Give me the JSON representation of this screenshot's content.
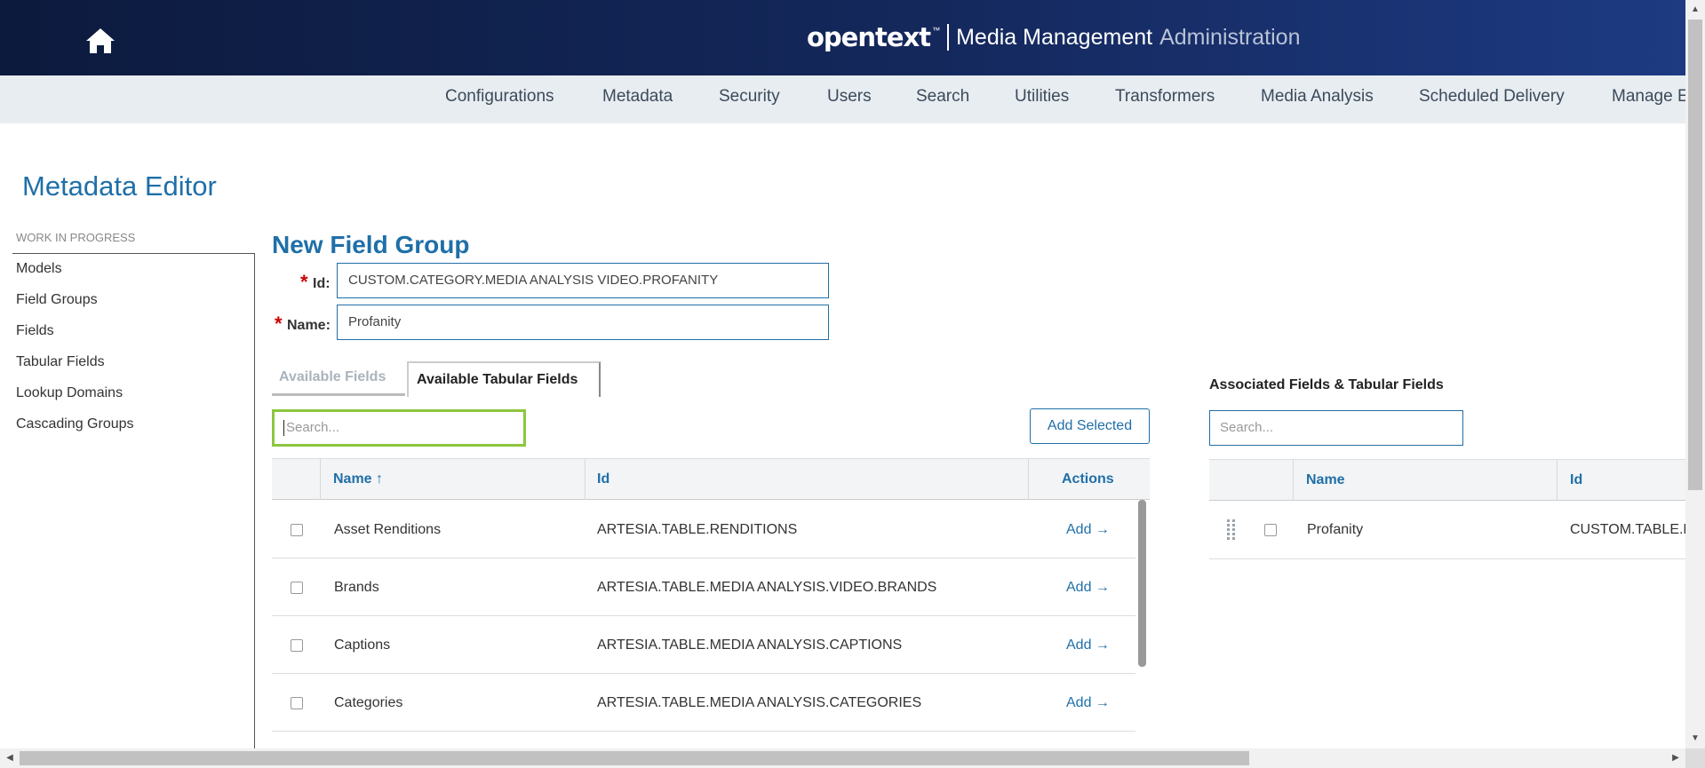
{
  "header": {
    "brand_logo": "opentext",
    "brand_tm": "™",
    "app_name": "Media Management",
    "app_name_suffix": "Administration"
  },
  "nav": {
    "items": [
      "Configurations",
      "Metadata",
      "Security",
      "Users",
      "Search",
      "Utilities",
      "Transformers",
      "Media Analysis",
      "Scheduled Delivery",
      "Manage E"
    ]
  },
  "page": {
    "title": "Metadata Editor"
  },
  "sidebar": {
    "header": "WORK IN PROGRESS",
    "items": [
      "Models",
      "Field Groups",
      "Fields",
      "Tabular Fields",
      "Lookup Domains",
      "Cascading Groups"
    ]
  },
  "form": {
    "title": "New Field Group",
    "required_mark": "*",
    "id_label": "Id:",
    "id_value": "CUSTOM.CATEGORY.MEDIA ANALYSIS VIDEO.PROFANITY",
    "name_label": "Name:",
    "name_value": "Profanity"
  },
  "tabs": {
    "available_fields": "Available Fields",
    "available_tabular_fields": "Available Tabular Fields"
  },
  "available": {
    "search_placeholder": "Search...",
    "add_selected_label": "Add Selected",
    "columns": {
      "name": "Name ↑",
      "id": "Id",
      "actions": "Actions"
    },
    "add_label": "Add →",
    "rows": [
      {
        "name": "Asset Renditions",
        "id": "ARTESIA.TABLE.RENDITIONS"
      },
      {
        "name": "Brands",
        "id": "ARTESIA.TABLE.MEDIA ANALYSIS.VIDEO.BRANDS"
      },
      {
        "name": "Captions",
        "id": "ARTESIA.TABLE.MEDIA ANALYSIS.CAPTIONS"
      },
      {
        "name": "Categories",
        "id": "ARTESIA.TABLE.MEDIA ANALYSIS.CATEGORIES"
      }
    ]
  },
  "associated": {
    "title": "Associated Fields & Tabular Fields",
    "search_placeholder": "Search...",
    "columns": {
      "name": "Name",
      "id": "Id"
    },
    "rows": [
      {
        "name": "Profanity",
        "id": "CUSTOM.TABLE.M"
      }
    ]
  },
  "colors": {
    "header_dark": "#0c1a3d",
    "accent_blue": "#1f6fa8",
    "focus_green": "#8cc63f",
    "required_red": "#cc0000"
  },
  "icons": {
    "home": "home-icon",
    "drag": "drag-handle-icon",
    "scroll_up": "scroll-up-arrow-icon",
    "scroll_down": "scroll-down-arrow-icon",
    "scroll_left": "scroll-left-arrow-icon",
    "scroll_right": "scroll-right-arrow-icon"
  }
}
